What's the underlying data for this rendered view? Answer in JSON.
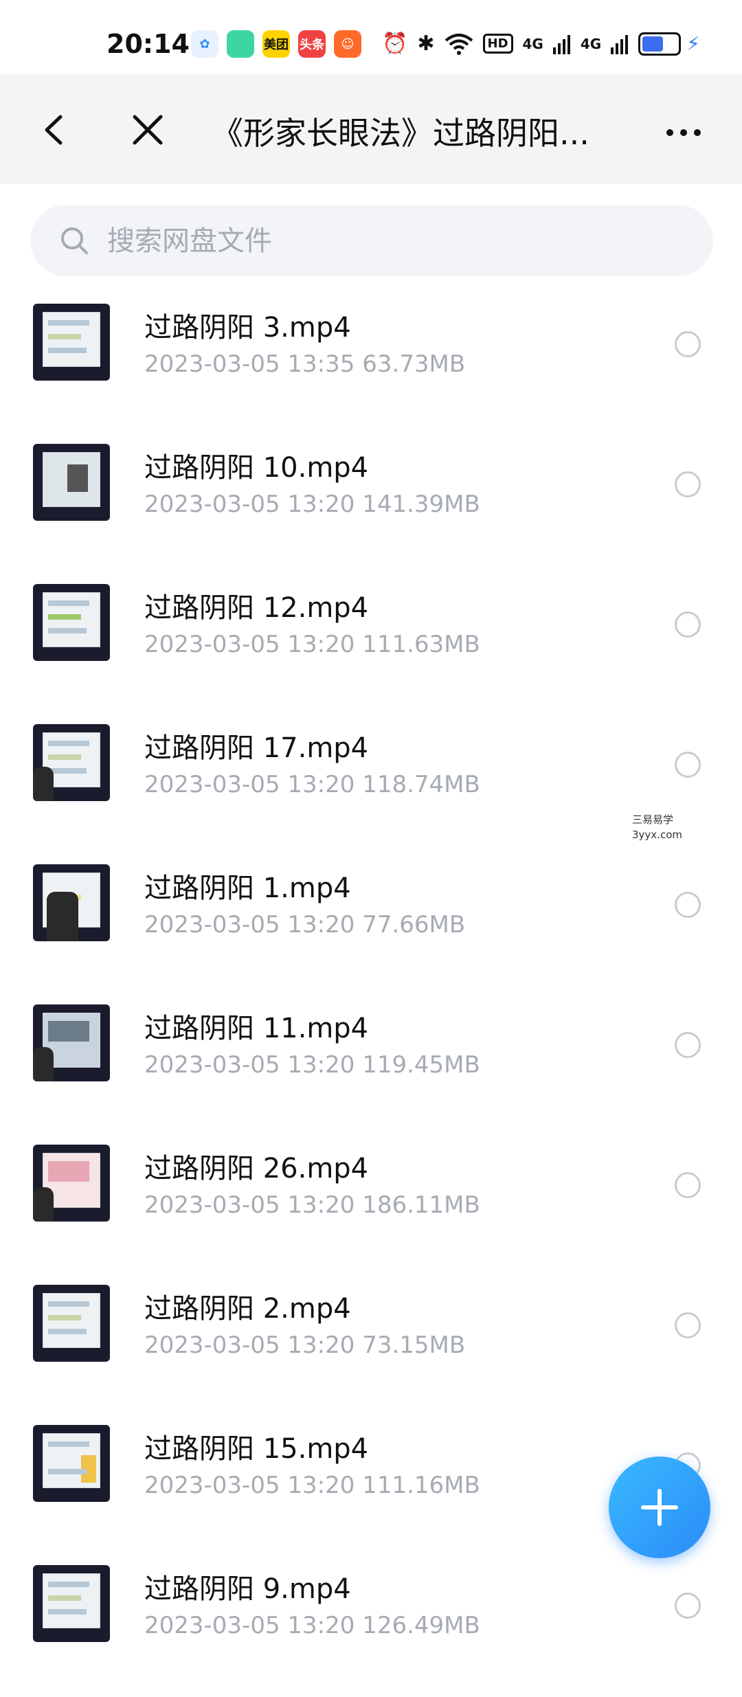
{
  "status_bar": {
    "time": "20:14",
    "app_icons": [
      {
        "name": "baidu-netdisk-icon",
        "label": ""
      },
      {
        "name": "green-app-icon",
        "label": ""
      },
      {
        "name": "meituan-icon",
        "label": "美团"
      },
      {
        "name": "toutiao-icon",
        "label": "头条"
      },
      {
        "name": "orange-app-icon",
        "label": ""
      }
    ],
    "network_hd": "HD",
    "signal_1": "4G",
    "signal_2": "4G"
  },
  "header": {
    "title": "《形家长眼法》过路阴阳..."
  },
  "search": {
    "placeholder": "搜索网盘文件"
  },
  "files": [
    {
      "name": "过路阴阳 3.mp4",
      "meta": "2023-03-05  13:35   63.73MB"
    },
    {
      "name": "过路阴阳 10.mp4",
      "meta": "2023-03-05  13:20   141.39MB"
    },
    {
      "name": "过路阴阳 12.mp4",
      "meta": "2023-03-05  13:20   111.63MB"
    },
    {
      "name": "过路阴阳 17.mp4",
      "meta": "2023-03-05  13:20   118.74MB"
    },
    {
      "name": "过路阴阳 1.mp4",
      "meta": "2023-03-05  13:20   77.66MB"
    },
    {
      "name": "过路阴阳 11.mp4",
      "meta": "2023-03-05  13:20   119.45MB"
    },
    {
      "name": "过路阴阳 26.mp4",
      "meta": "2023-03-05  13:20   186.11MB"
    },
    {
      "name": "过路阴阳 2.mp4",
      "meta": "2023-03-05  13:20   73.15MB"
    },
    {
      "name": "过路阴阳 15.mp4",
      "meta": "2023-03-05  13:20   111.16MB"
    },
    {
      "name": "过路阴阳 9.mp4",
      "meta": "2023-03-05  13:20   126.49MB"
    }
  ],
  "watermark": {
    "line1": "三易易学",
    "line2": "3yyx.com"
  },
  "colors": {
    "accent": "#2a8cf8",
    "meta_text": "#a6abb3",
    "header_bg": "#f3f4f6"
  }
}
